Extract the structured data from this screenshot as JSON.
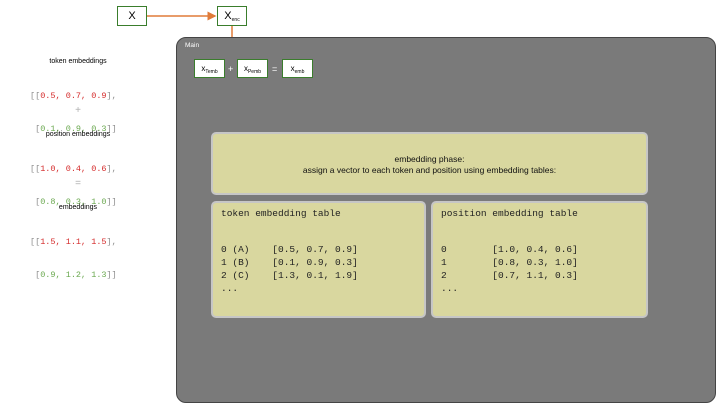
{
  "top": {
    "x_label": "X",
    "xenc_main": "X",
    "xenc_sub": "enc"
  },
  "left": {
    "token_title": "token embeddings",
    "token_rows": [
      [
        "0.5",
        "0.7",
        "0.9"
      ],
      [
        "0.1",
        "0.9",
        "0.3"
      ]
    ],
    "plus": "+",
    "position_title": "position embeddings",
    "position_rows": [
      [
        "1.0",
        "0.4",
        "0.6"
      ],
      [
        "0.8",
        "0.3",
        "1.0"
      ]
    ],
    "equals": "=",
    "emb_title": "embeddings",
    "emb_rows": [
      [
        "1.5",
        "1.1",
        "1.5"
      ],
      [
        "0.9",
        "1.2",
        "1.3"
      ]
    ]
  },
  "main": {
    "label": "Main",
    "eq": {
      "a_main": "x",
      "a_sub": "Temb",
      "plus": "+",
      "b_main": "x",
      "b_sub": "Pemb",
      "equals": "=",
      "c_main": "x",
      "c_sub": "emb"
    },
    "phase_line1": "embedding phase:",
    "phase_line2": "assign a vector to each token and position using embedding tables:",
    "token_table": {
      "title": "token embedding table",
      "rows": [
        "0 (A)    [0.5, 0.7, 0.9]",
        "1 (B)    [0.1, 0.9, 0.3]",
        "2 (C)    [1.3, 0.1, 1.9]",
        "..."
      ]
    },
    "position_table": {
      "title": "position embedding table",
      "rows": [
        "0        [1.0, 0.4, 0.6]",
        "1        [0.8, 0.3, 1.0]",
        "2        [0.7, 1.1, 0.3]",
        "..."
      ]
    }
  },
  "colors": {
    "arrow": "#e07b39",
    "box_border": "#3a7d2c",
    "main_bg": "#7a7a7a",
    "panel_bg": "#d9d79f"
  }
}
